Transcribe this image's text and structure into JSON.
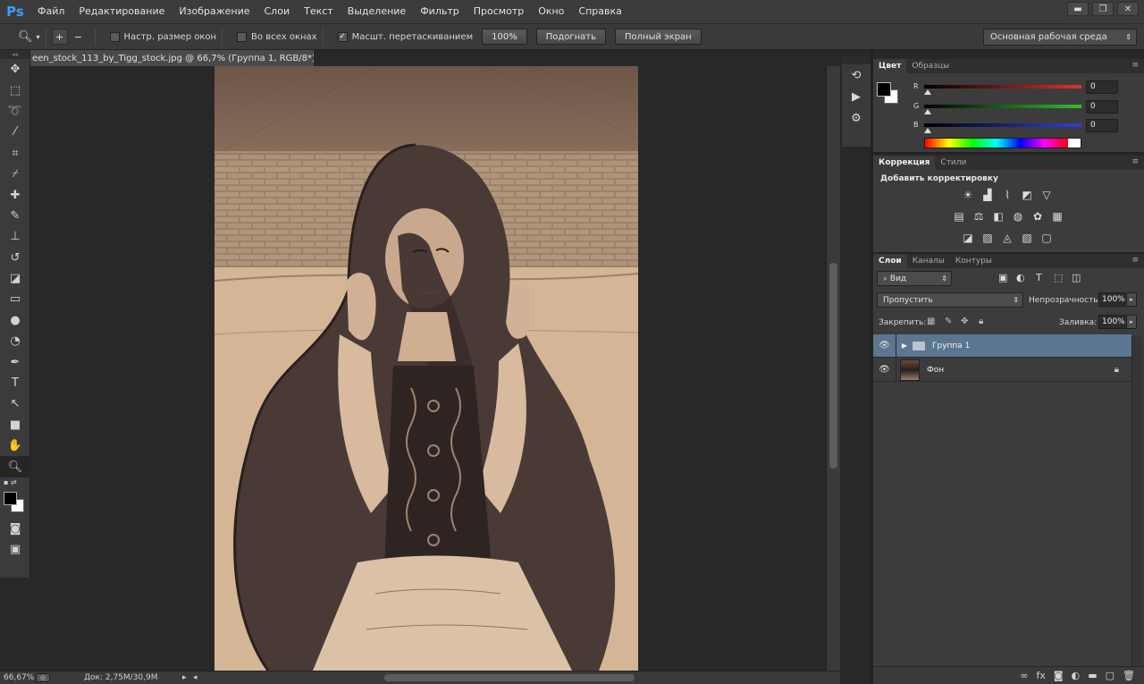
{
  "app": {
    "logo": "Ps"
  },
  "menu": [
    "Файл",
    "Редактирование",
    "Изображение",
    "Слои",
    "Текст",
    "Выделение",
    "Фильтр",
    "Просмотр",
    "Окно",
    "Справка"
  ],
  "window_controls": [
    "▬",
    "❐",
    "✕"
  ],
  "options_bar": {
    "tool_icon": "zoom-icon",
    "chk_resize": "Настр. размер окон",
    "chk_all": "Во всех окнах",
    "chk_scrubby": "Масшт. перетаскиванием",
    "btn_100": "100%",
    "btn_fit": "Подогнать",
    "btn_full": "Полный экран",
    "workspace": "Основная рабочая среда"
  },
  "document": {
    "tab_title": "een_stock_113_by_Tigg_stock.jpg @ 66,7% (Группа 1, RGB/8*) *",
    "tab_close": "×"
  },
  "status": {
    "zoom": "66,67%",
    "doc_size": "Док: 2,75M/30,9M"
  },
  "color_panel": {
    "tabs": [
      "Цвет",
      "Образцы"
    ],
    "sliders": [
      {
        "label": "R",
        "value": "0",
        "color": "#e03030"
      },
      {
        "label": "G",
        "value": "0",
        "color": "#30c030"
      },
      {
        "label": "B",
        "value": "0",
        "color": "#3040e0"
      }
    ]
  },
  "adjustments_panel": {
    "tabs": [
      "Коррекция",
      "Стили"
    ],
    "title": "Добавить корректировку"
  },
  "layers_panel": {
    "tabs": [
      "Слои",
      "Каналы",
      "Контуры"
    ],
    "filter": "Вид",
    "blend_mode": "Пропустить",
    "opacity_label": "Непрозрачность:",
    "opacity": "100%",
    "lock_label": "Закрепить:",
    "fill_label": "Заливка:",
    "fill": "100%",
    "layers": [
      {
        "name": "Группа 1",
        "type": "group",
        "selected": true
      },
      {
        "name": "Фон",
        "type": "image",
        "locked": true
      }
    ]
  },
  "colors": {
    "accent_selection": "#5b7691",
    "canvas_tone": "#c4a485"
  }
}
